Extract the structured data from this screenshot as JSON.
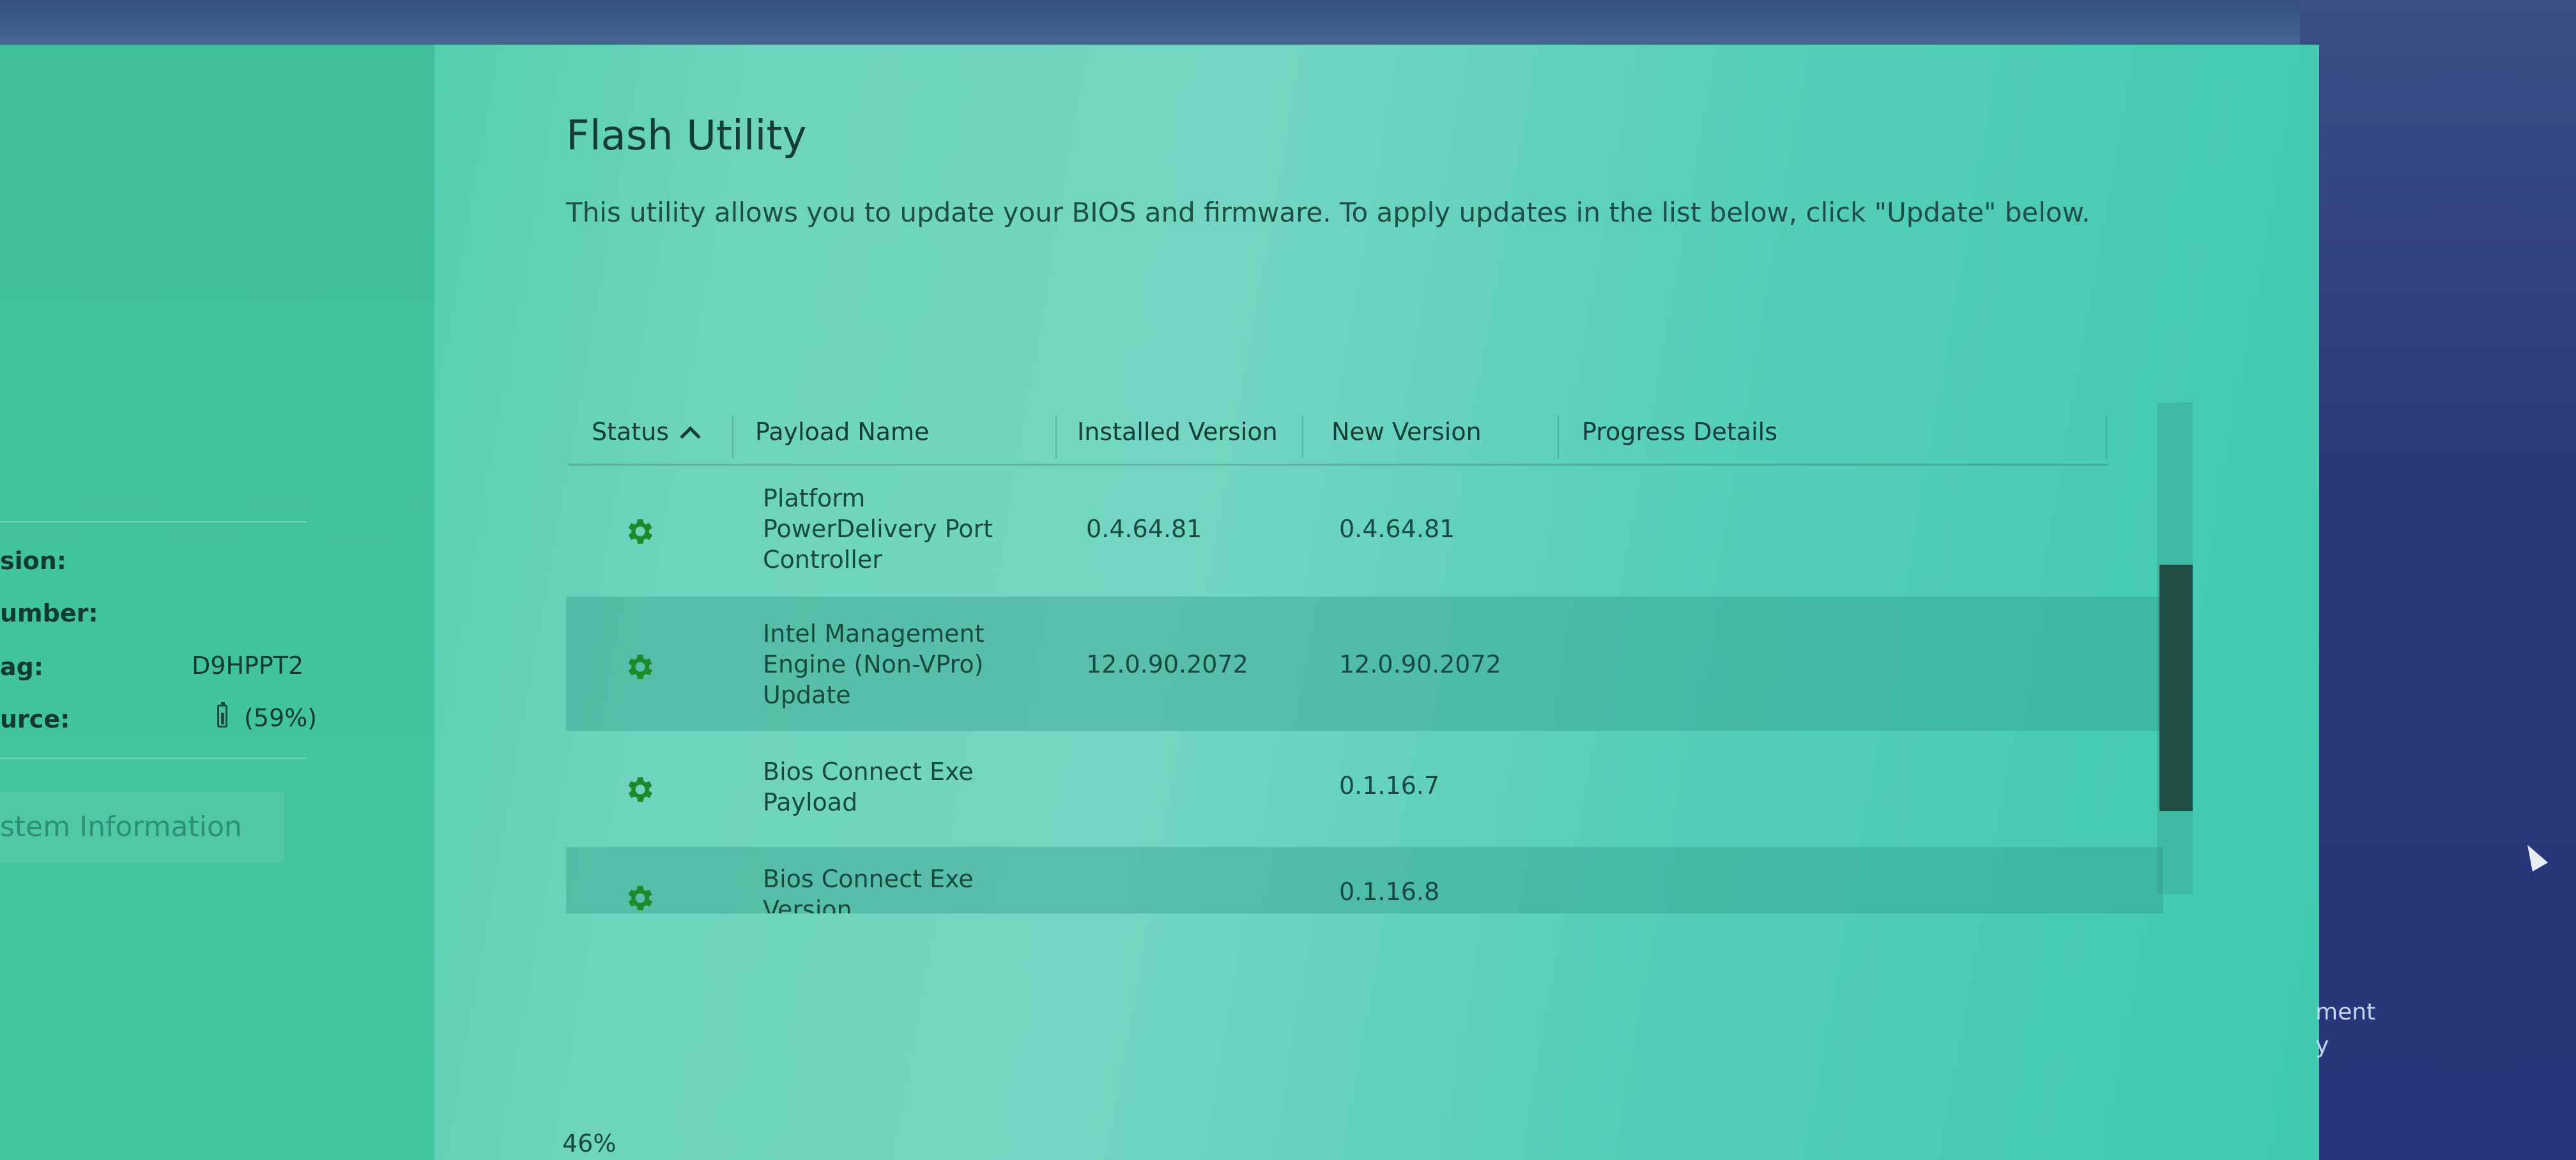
{
  "sidebar": {
    "labels": [
      "sion:",
      "umber:",
      "ag:",
      "urce:"
    ],
    "service_tag": "D9HPPT2",
    "battery": "(59%)",
    "system_info_link": "stem Information"
  },
  "main": {
    "title": "Flash Utility",
    "description": "This utility allows you to update your BIOS and firmware. To apply updates in the list below, click \"Update\" below."
  },
  "table": {
    "columns": [
      "Status",
      "Payload Name",
      "Installed Version",
      "New Version",
      "Progress Details"
    ],
    "rows": [
      {
        "name_lines": [
          "Platform",
          "PowerDelivery Port",
          "Controller"
        ],
        "installed": "0.4.64.81",
        "new": "0.4.64.81"
      },
      {
        "name_lines": [
          "Intel Management",
          "Engine (Non-VPro)",
          "Update"
        ],
        "installed": "12.0.90.2072",
        "new": "12.0.90.2072"
      },
      {
        "name_lines": [
          "Bios Connect Exe",
          "Payload"
        ],
        "installed": "",
        "new": "0.1.16.7"
      },
      {
        "name_lines": [
          "Bios Connect Exe",
          "Version"
        ],
        "installed": "",
        "new": "0.1.16.8"
      }
    ]
  },
  "progress": "46%",
  "right_edge": {
    "line1": "ment",
    "line2": "y"
  },
  "colors": {
    "gear": "#1c8a2a",
    "scroll_thumb": "#1f4e44"
  }
}
